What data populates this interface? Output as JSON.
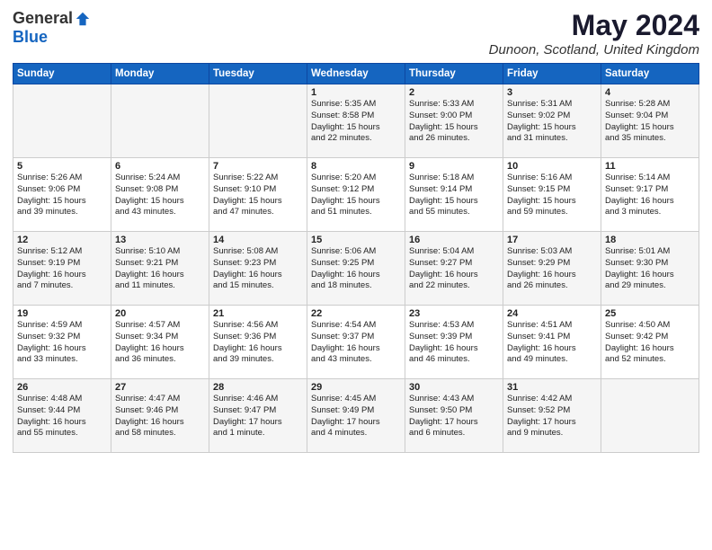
{
  "logo": {
    "general": "General",
    "blue": "Blue"
  },
  "title": "May 2024",
  "subtitle": "Dunoon, Scotland, United Kingdom",
  "headers": [
    "Sunday",
    "Monday",
    "Tuesday",
    "Wednesday",
    "Thursday",
    "Friday",
    "Saturday"
  ],
  "weeks": [
    [
      {
        "day": "",
        "info": ""
      },
      {
        "day": "",
        "info": ""
      },
      {
        "day": "",
        "info": ""
      },
      {
        "day": "1",
        "info": "Sunrise: 5:35 AM\nSunset: 8:58 PM\nDaylight: 15 hours\nand 22 minutes."
      },
      {
        "day": "2",
        "info": "Sunrise: 5:33 AM\nSunset: 9:00 PM\nDaylight: 15 hours\nand 26 minutes."
      },
      {
        "day": "3",
        "info": "Sunrise: 5:31 AM\nSunset: 9:02 PM\nDaylight: 15 hours\nand 31 minutes."
      },
      {
        "day": "4",
        "info": "Sunrise: 5:28 AM\nSunset: 9:04 PM\nDaylight: 15 hours\nand 35 minutes."
      }
    ],
    [
      {
        "day": "5",
        "info": "Sunrise: 5:26 AM\nSunset: 9:06 PM\nDaylight: 15 hours\nand 39 minutes."
      },
      {
        "day": "6",
        "info": "Sunrise: 5:24 AM\nSunset: 9:08 PM\nDaylight: 15 hours\nand 43 minutes."
      },
      {
        "day": "7",
        "info": "Sunrise: 5:22 AM\nSunset: 9:10 PM\nDaylight: 15 hours\nand 47 minutes."
      },
      {
        "day": "8",
        "info": "Sunrise: 5:20 AM\nSunset: 9:12 PM\nDaylight: 15 hours\nand 51 minutes."
      },
      {
        "day": "9",
        "info": "Sunrise: 5:18 AM\nSunset: 9:14 PM\nDaylight: 15 hours\nand 55 minutes."
      },
      {
        "day": "10",
        "info": "Sunrise: 5:16 AM\nSunset: 9:15 PM\nDaylight: 15 hours\nand 59 minutes."
      },
      {
        "day": "11",
        "info": "Sunrise: 5:14 AM\nSunset: 9:17 PM\nDaylight: 16 hours\nand 3 minutes."
      }
    ],
    [
      {
        "day": "12",
        "info": "Sunrise: 5:12 AM\nSunset: 9:19 PM\nDaylight: 16 hours\nand 7 minutes."
      },
      {
        "day": "13",
        "info": "Sunrise: 5:10 AM\nSunset: 9:21 PM\nDaylight: 16 hours\nand 11 minutes."
      },
      {
        "day": "14",
        "info": "Sunrise: 5:08 AM\nSunset: 9:23 PM\nDaylight: 16 hours\nand 15 minutes."
      },
      {
        "day": "15",
        "info": "Sunrise: 5:06 AM\nSunset: 9:25 PM\nDaylight: 16 hours\nand 18 minutes."
      },
      {
        "day": "16",
        "info": "Sunrise: 5:04 AM\nSunset: 9:27 PM\nDaylight: 16 hours\nand 22 minutes."
      },
      {
        "day": "17",
        "info": "Sunrise: 5:03 AM\nSunset: 9:29 PM\nDaylight: 16 hours\nand 26 minutes."
      },
      {
        "day": "18",
        "info": "Sunrise: 5:01 AM\nSunset: 9:30 PM\nDaylight: 16 hours\nand 29 minutes."
      }
    ],
    [
      {
        "day": "19",
        "info": "Sunrise: 4:59 AM\nSunset: 9:32 PM\nDaylight: 16 hours\nand 33 minutes."
      },
      {
        "day": "20",
        "info": "Sunrise: 4:57 AM\nSunset: 9:34 PM\nDaylight: 16 hours\nand 36 minutes."
      },
      {
        "day": "21",
        "info": "Sunrise: 4:56 AM\nSunset: 9:36 PM\nDaylight: 16 hours\nand 39 minutes."
      },
      {
        "day": "22",
        "info": "Sunrise: 4:54 AM\nSunset: 9:37 PM\nDaylight: 16 hours\nand 43 minutes."
      },
      {
        "day": "23",
        "info": "Sunrise: 4:53 AM\nSunset: 9:39 PM\nDaylight: 16 hours\nand 46 minutes."
      },
      {
        "day": "24",
        "info": "Sunrise: 4:51 AM\nSunset: 9:41 PM\nDaylight: 16 hours\nand 49 minutes."
      },
      {
        "day": "25",
        "info": "Sunrise: 4:50 AM\nSunset: 9:42 PM\nDaylight: 16 hours\nand 52 minutes."
      }
    ],
    [
      {
        "day": "26",
        "info": "Sunrise: 4:48 AM\nSunset: 9:44 PM\nDaylight: 16 hours\nand 55 minutes."
      },
      {
        "day": "27",
        "info": "Sunrise: 4:47 AM\nSunset: 9:46 PM\nDaylight: 16 hours\nand 58 minutes."
      },
      {
        "day": "28",
        "info": "Sunrise: 4:46 AM\nSunset: 9:47 PM\nDaylight: 17 hours\nand 1 minute."
      },
      {
        "day": "29",
        "info": "Sunrise: 4:45 AM\nSunset: 9:49 PM\nDaylight: 17 hours\nand 4 minutes."
      },
      {
        "day": "30",
        "info": "Sunrise: 4:43 AM\nSunset: 9:50 PM\nDaylight: 17 hours\nand 6 minutes."
      },
      {
        "day": "31",
        "info": "Sunrise: 4:42 AM\nSunset: 9:52 PM\nDaylight: 17 hours\nand 9 minutes."
      },
      {
        "day": "",
        "info": ""
      }
    ]
  ]
}
